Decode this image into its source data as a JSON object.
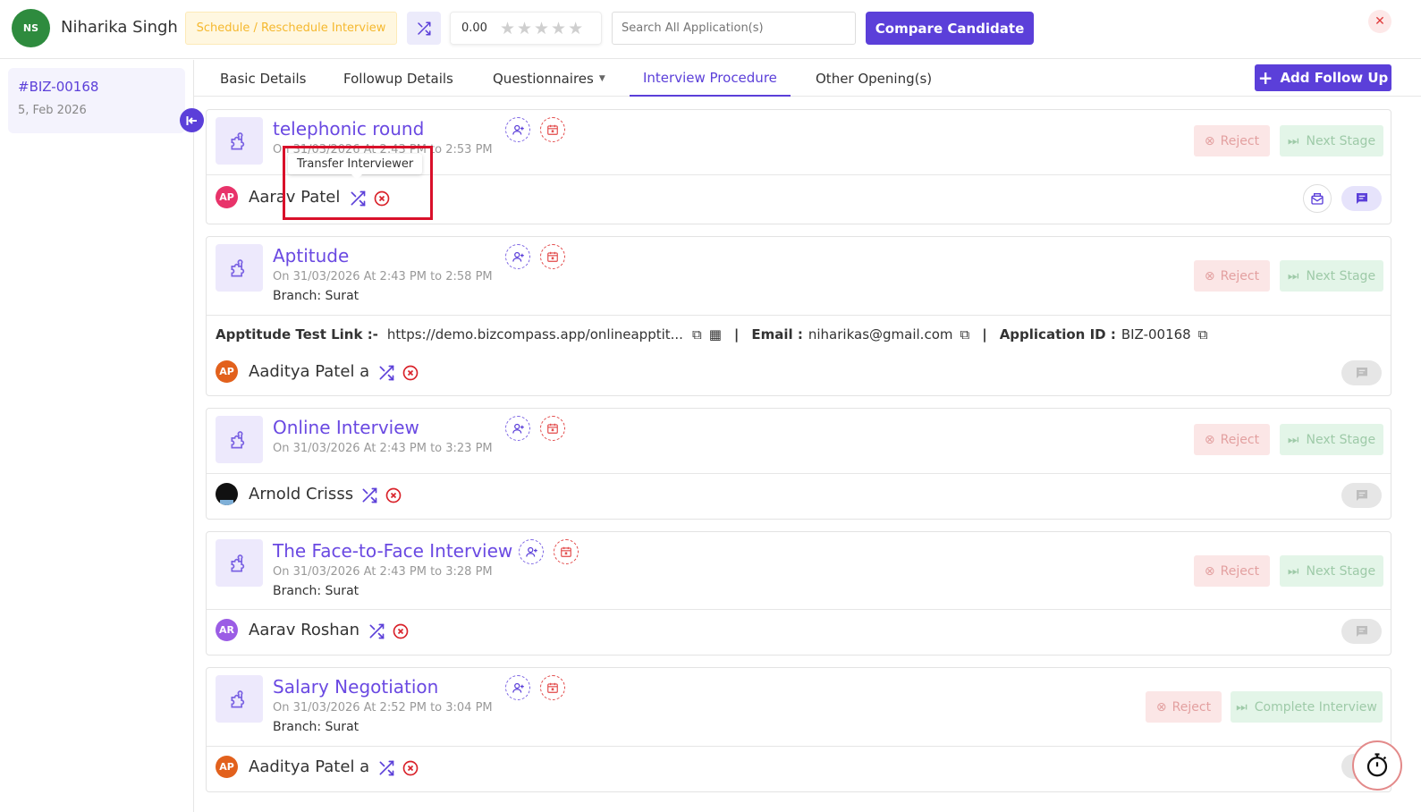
{
  "header": {
    "avatar_initials": "NS",
    "candidate_name": "Niharika Singh",
    "schedule_label": "Schedule / Reschedule Interview",
    "rating_value": "0.00",
    "rating_stars": 0,
    "search_placeholder": "Search All Application(s)",
    "compare_label": "Compare Candidate",
    "close_icon": "close-icon"
  },
  "sidebar": {
    "app_id": "#BIZ-00168",
    "app_date": "5, Feb 2026"
  },
  "tabs": [
    {
      "label": "Basic Details"
    },
    {
      "label": "Followup Details"
    },
    {
      "label": "Questionnaires"
    },
    {
      "label": "Interview Procedure",
      "active": true
    },
    {
      "label": "Other Opening(s)"
    }
  ],
  "add_followup_label": "Add Follow Up",
  "tooltip": "Transfer Interviewer",
  "buttons": {
    "reject": "Reject",
    "next_stage": "Next Stage",
    "complete_interview": "Complete Interview"
  },
  "stages": [
    {
      "title": "telephonic round",
      "time": "On 31/03/2026 At 2:43 PM to 2:53 PM",
      "interviewer": {
        "initials": "AP",
        "name": "Aarav Patel",
        "color": "#e8336a"
      }
    },
    {
      "title": "Aptitude",
      "time": "On 31/03/2026 At 2:43 PM to 2:58 PM",
      "branch": "Branch: Surat",
      "test_link_label": "Apptitude Test Link :-",
      "test_link_value": "https://demo.bizcompass.app/onlineapptit...",
      "email_label": "Email :",
      "email_value": "niharikas@gmail.com",
      "app_id_label": "Application ID :",
      "app_id_value": "BIZ-00168",
      "interviewer": {
        "initials": "AP",
        "name": "Aaditya Patel a",
        "color": "#e2611d"
      }
    },
    {
      "title": "Online Interview",
      "time": "On 31/03/2026 At 2:43 PM to 3:23 PM",
      "interviewer": {
        "initials": "",
        "name": "Arnold Crisss",
        "color": "#111111"
      }
    },
    {
      "title": "The Face-to-Face Interview",
      "time": "On 31/03/2026 At 2:43 PM to 3:28 PM",
      "branch": "Branch: Surat",
      "interviewer": {
        "initials": "AR",
        "name": "Aarav Roshan",
        "color": "#9b5de5"
      }
    },
    {
      "title": "Salary Negotiation",
      "time": "On 31/03/2026 At 2:52 PM to 3:04 PM",
      "branch": "Branch: Surat",
      "interviewer": {
        "initials": "AP",
        "name": "Aaditya Patel a",
        "color": "#e2611d"
      }
    }
  ],
  "colors": {
    "accent": "#5b3fd9",
    "danger": "#e24848"
  }
}
